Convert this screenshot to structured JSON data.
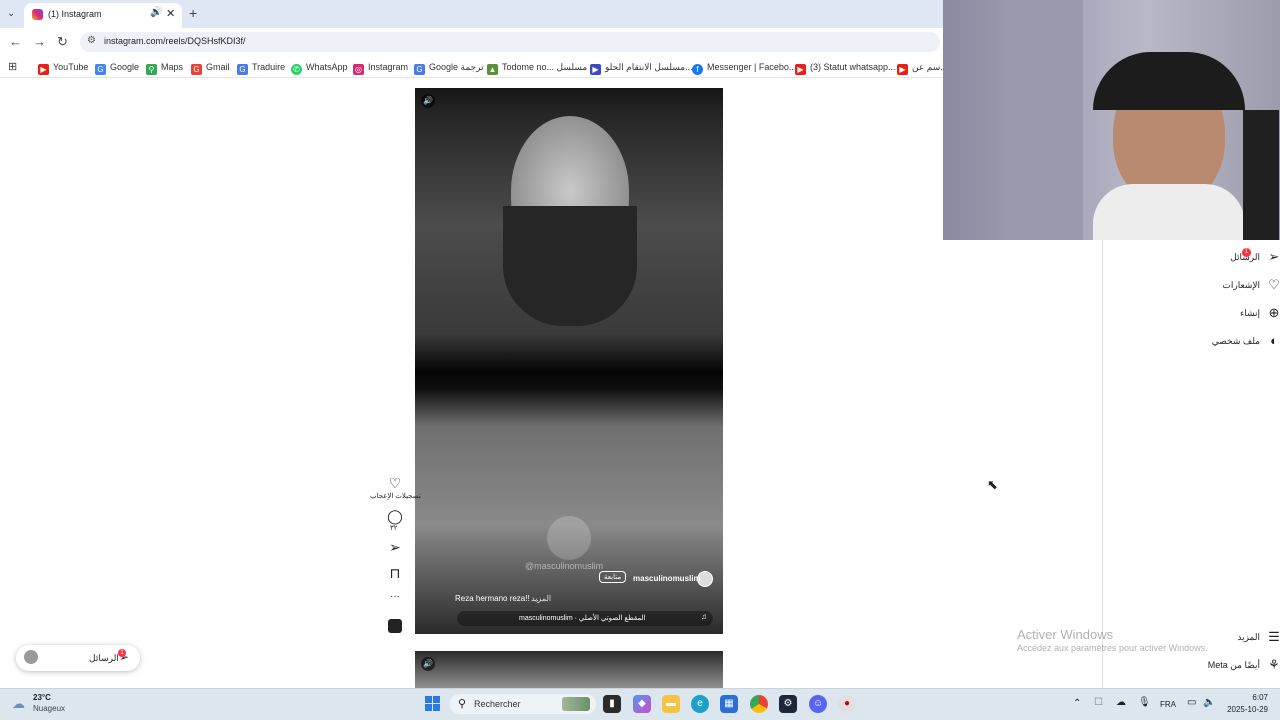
{
  "browser": {
    "tab_title": "(1) Instagram",
    "new_tab_glyph": "+",
    "url": "instagram.com/reels/DQSHsfKDI3f/",
    "bookmarks": [
      {
        "label": "YouTube",
        "icon": "youtube-icon",
        "color": "#e62117"
      },
      {
        "label": "Google",
        "icon": "google-icon",
        "color": "#4285f4"
      },
      {
        "label": "Maps",
        "icon": "maps-icon",
        "color": "#34a853"
      },
      {
        "label": "Gmail",
        "icon": "gmail-icon",
        "color": "#ea4335"
      },
      {
        "label": "Traduire",
        "icon": "translate-icon",
        "color": "#4a7be8"
      },
      {
        "label": "WhatsApp",
        "icon": "whatsapp-icon",
        "color": "#25d366"
      },
      {
        "label": "Instagram",
        "icon": "instagram-icon",
        "color": "#d62976"
      },
      {
        "label": "Google ترجمة",
        "icon": "translate-icon",
        "color": "#4a7be8"
      },
      {
        "label": "Todome no... مسلسل",
        "icon": "app-icon",
        "color": "#5a8f3c"
      },
      {
        "label": "مسلسل الانتقام الحلو...",
        "icon": "play-icon",
        "color": "#3b4cc0"
      },
      {
        "label": "Messenger | Facebo...",
        "icon": "facebook-icon",
        "color": "#1877f2"
      },
      {
        "label": "(3) Statut whatsapp...",
        "icon": "youtube-icon",
        "color": "#e62117"
      },
      {
        "label": "سم عن...",
        "icon": "youtube-icon",
        "color": "#e62117"
      }
    ]
  },
  "reel": {
    "watermark": "@masculinomuslim",
    "username": "masculinomuslim",
    "follow_label": "متابعة",
    "caption": "Reza hermano reza!! ...",
    "more_label": "المزيد",
    "audio": "masculinomuslim · المقطع الصوتي الأصلي",
    "likes_label": "تسجيلات الإعجاب",
    "comments_count": "٣٢"
  },
  "sidebar": {
    "messages": "الرسائل",
    "messages_badge": "1",
    "notifications": "الإشعارات",
    "create": "إنشاء",
    "profile": "ملف شخصي",
    "more": "المزيد",
    "also_from_meta": "أيضًا من Meta"
  },
  "messages_pill": {
    "label": "الرسائل",
    "badge": "1"
  },
  "windows": {
    "activate_title": "Activer Windows",
    "activate_sub": "Accédez aux paramètres pour activer Windows."
  },
  "taskbar": {
    "temperature": "23°C",
    "weather": "Nuageux",
    "search_placeholder": "Rechercher",
    "language": "FRA",
    "time": "6:07",
    "date": "2025-10-29"
  }
}
